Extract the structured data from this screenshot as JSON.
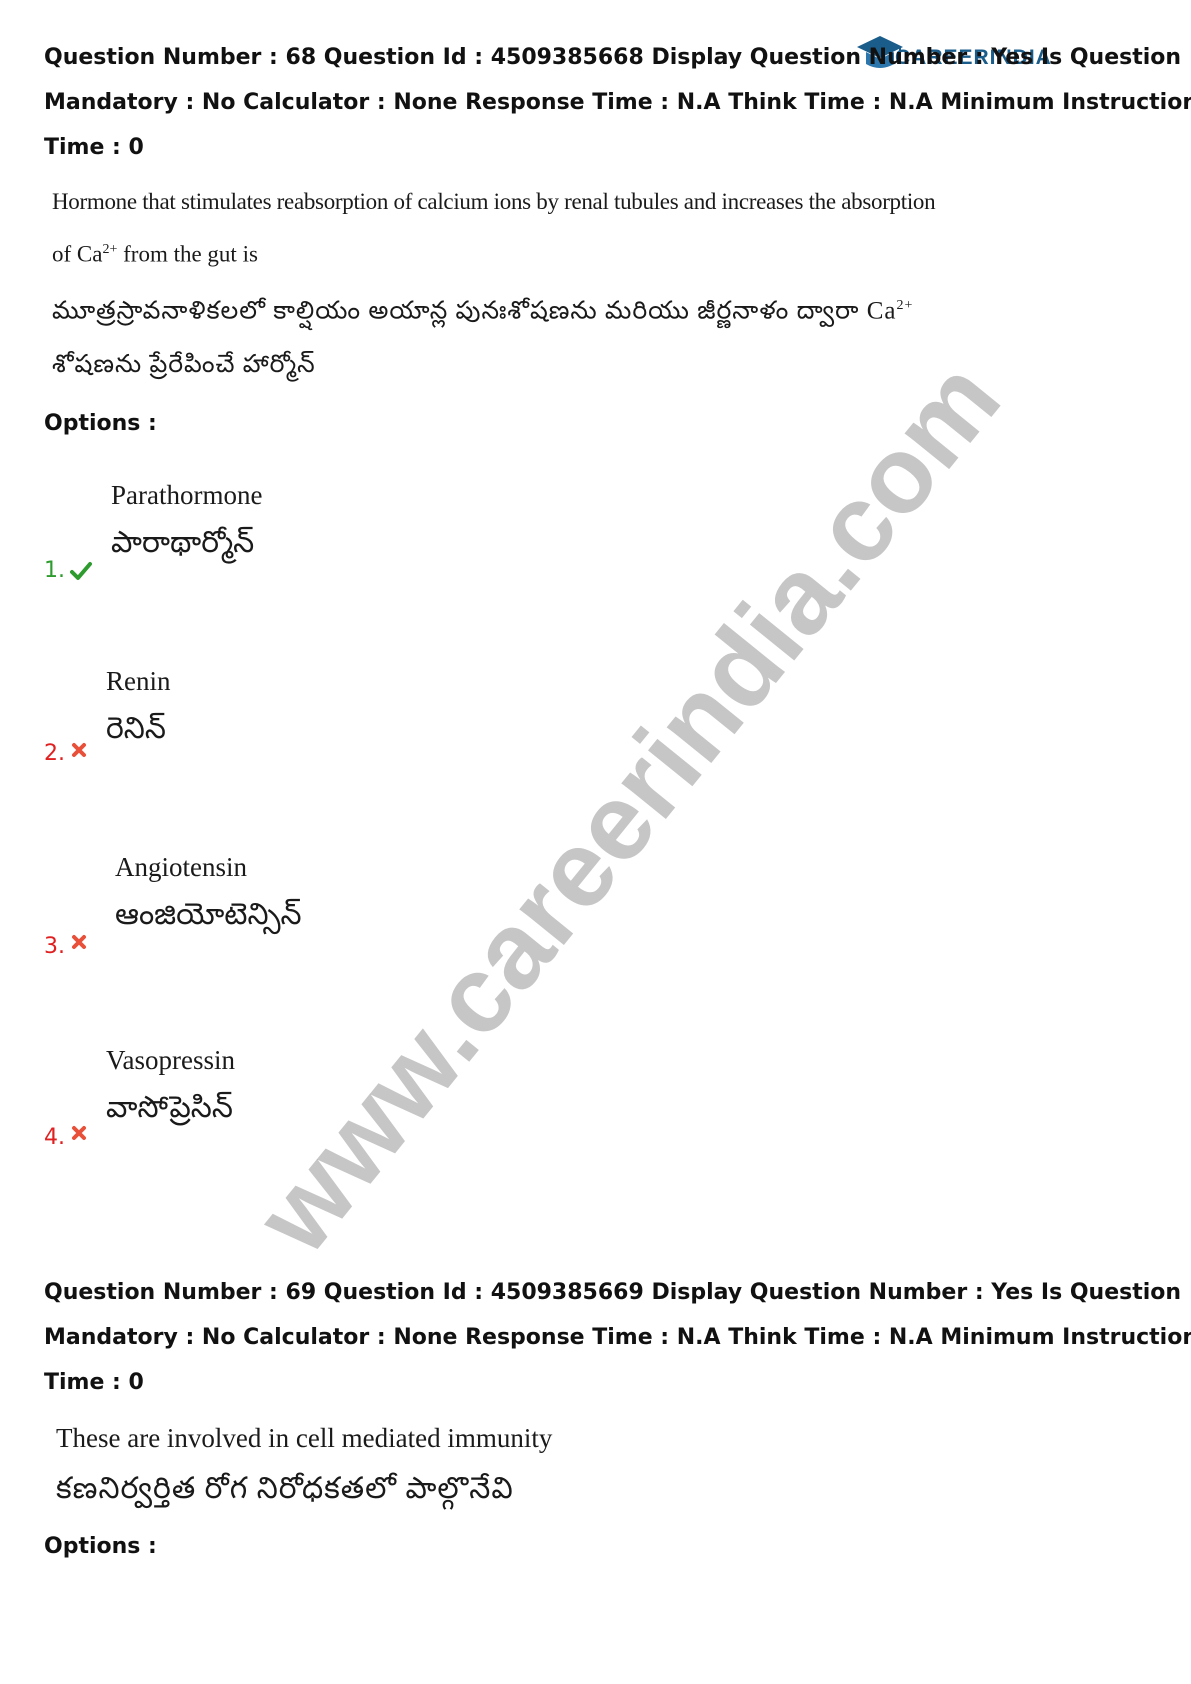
{
  "branding": {
    "logo_text": "CAREERINDIA",
    "watermark_text": "www.careerindia.com"
  },
  "questions": [
    {
      "meta_lines": [
        "Question Number : 68 Question Id : 4509385668 Display Question Number : Yes Is Question",
        "Mandatory : No Calculator : None Response Time : N.A Think Time : N.A Minimum Instruction",
        "Time : 0"
      ],
      "text_en_line1": "Hormone that stimulates reabsorption of calcium ions by renal tubules and increases the absorption",
      "text_en_line2_pre": "of Ca",
      "text_en_line2_sup": "2+",
      "text_en_line2_post": " from the gut is",
      "text_te_line1_pre": "మూత్రస్రావనాళికలలో కాల్షియం అయాన్ల పునఃశోషణను మరియు జీర్ణనాళం ద్వారా Ca",
      "text_te_line1_sup": "2+",
      "text_te_line2": "శోషణను ప్రేరేపించే హార్మోన్",
      "options_label": "Options :",
      "options": [
        {
          "number": "1.",
          "status": "correct",
          "icon": "check-icon",
          "en": "Parathormone",
          "te": "పారాథార్మోన్"
        },
        {
          "number": "2.",
          "status": "wrong",
          "icon": "cross-icon",
          "en": "Renin",
          "te": "రెనిన్"
        },
        {
          "number": "3.",
          "status": "wrong",
          "icon": "cross-icon",
          "en": "Angiotensin",
          "te": "ఆంజియోటెన్సిన్"
        },
        {
          "number": "4.",
          "status": "wrong",
          "icon": "cross-icon",
          "en": "Vasopressin",
          "te": "వాసోప్రెసిన్"
        }
      ]
    },
    {
      "meta_lines": [
        "Question Number : 69 Question Id : 4509385669 Display Question Number : Yes Is Question",
        "Mandatory : No Calculator : None Response Time : N.A Think Time : N.A Minimum Instruction",
        "Time : 0"
      ],
      "text_en_line1": "These are involved in cell mediated immunity",
      "text_te_line1": "కణనిర్వర్తిత రోగ నిరోధకతలో పాల్గొనేవి",
      "options_label": "Options :"
    }
  ],
  "colors": {
    "correct": "#2e9b2e",
    "wrong": "#e02020",
    "logo": "#1b5d8a"
  }
}
